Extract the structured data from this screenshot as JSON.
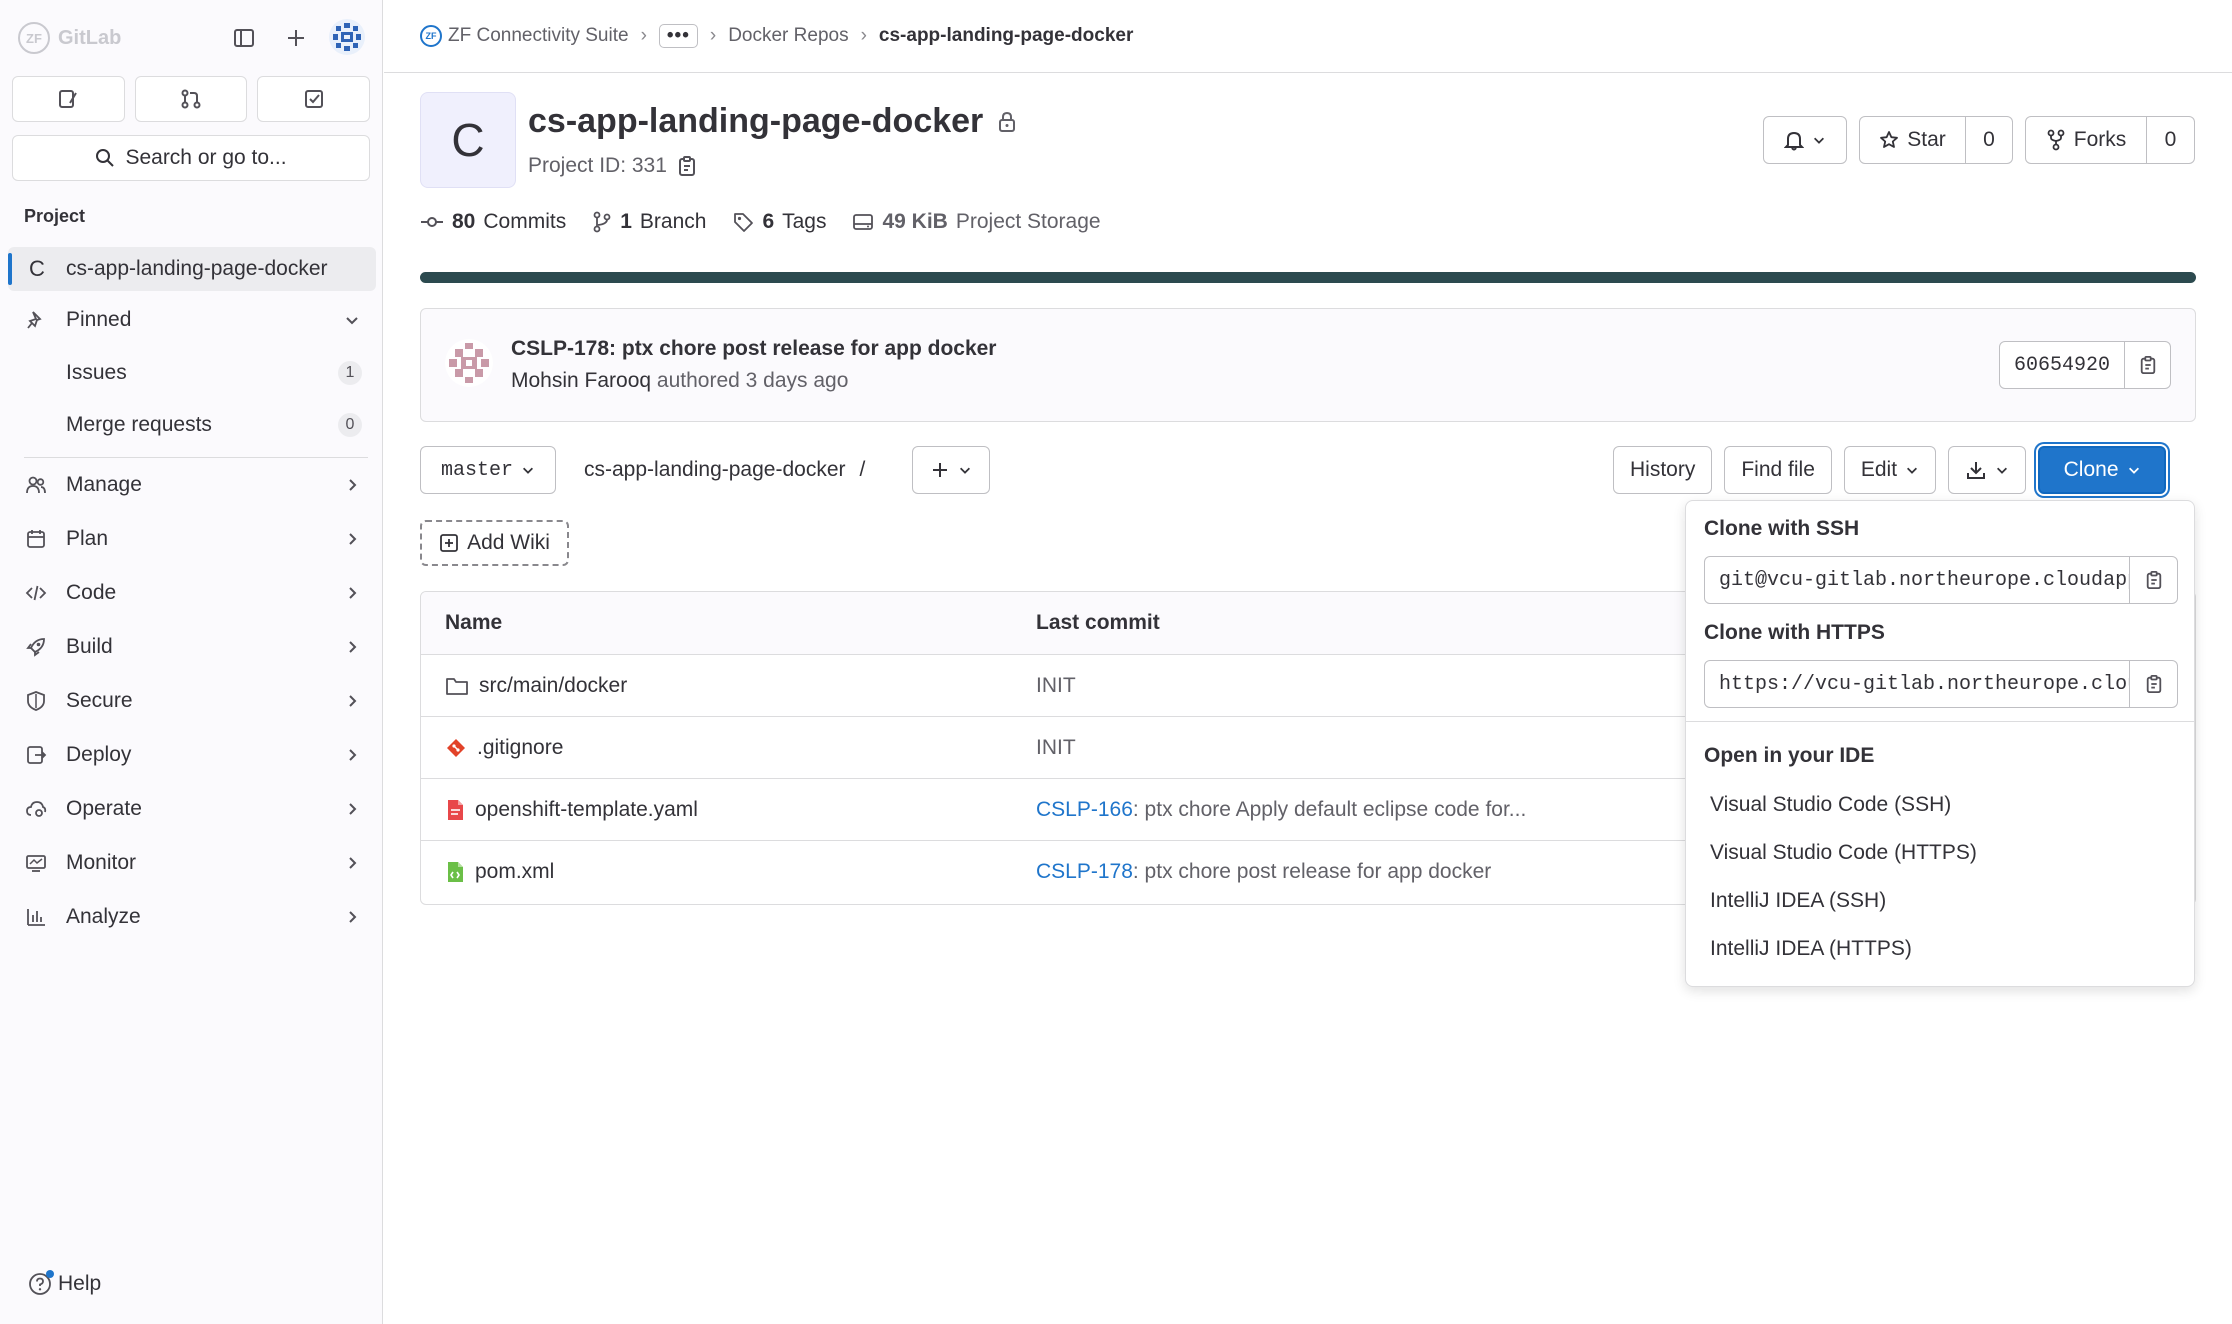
{
  "sidebar": {
    "brand": "GitLab",
    "search_placeholder": "Search or go to...",
    "section_title": "Project",
    "project_avatar_letter": "C",
    "project_name": "cs-app-landing-page-docker",
    "pinned_label": "Pinned",
    "pinned_items": [
      {
        "label": "Issues",
        "count": "1"
      },
      {
        "label": "Merge requests",
        "count": "0"
      }
    ],
    "nav_items": [
      {
        "label": "Manage",
        "icon": "users-icon"
      },
      {
        "label": "Plan",
        "icon": "calendar-icon"
      },
      {
        "label": "Code",
        "icon": "code-icon"
      },
      {
        "label": "Build",
        "icon": "rocket-icon"
      },
      {
        "label": "Secure",
        "icon": "shield-icon"
      },
      {
        "label": "Deploy",
        "icon": "deployments-icon"
      },
      {
        "label": "Operate",
        "icon": "cloud-gear-icon"
      },
      {
        "label": "Monitor",
        "icon": "monitor-icon"
      },
      {
        "label": "Analyze",
        "icon": "chart-icon"
      }
    ],
    "help_label": "Help"
  },
  "breadcrumb": {
    "group_logo": "ZF",
    "group": "ZF Connectivity Suite",
    "more": "•••",
    "subgroup": "Docker Repos",
    "current": "cs-app-landing-page-docker"
  },
  "project": {
    "avatar_letter": "C",
    "title": "cs-app-landing-page-docker",
    "id_label": "Project ID: 331",
    "star_label": "Star",
    "star_count": "0",
    "forks_label": "Forks",
    "forks_count": "0",
    "stats": {
      "commits_count": "80",
      "commits_label": "Commits",
      "branches_count": "1",
      "branches_label": "Branch",
      "tags_count": "6",
      "tags_label": "Tags",
      "storage_size": "49 KiB",
      "storage_label": "Project Storage"
    },
    "language_bar_color": "#2c4a4f"
  },
  "last_commit": {
    "title": "CSLP-178: ptx chore post release for app docker",
    "author": "Mohsin Farooq",
    "meta": "authored 3 days ago",
    "sha": "60654920"
  },
  "tree": {
    "branch": "master",
    "path": "cs-app-landing-page-docker",
    "path_sep": "/",
    "history_label": "History",
    "find_file_label": "Find file",
    "edit_label": "Edit",
    "clone_label": "Clone",
    "add_wiki_label": "Add Wiki",
    "columns": {
      "name": "Name",
      "last_commit": "Last commit"
    },
    "rows": [
      {
        "name": "src/main/docker",
        "icon": "folder-icon",
        "commit_ref": "",
        "commit_text": "INIT"
      },
      {
        "name": ".gitignore",
        "icon": "git-icon",
        "commit_ref": "",
        "commit_text": "INIT"
      },
      {
        "name": "openshift-template.yaml",
        "icon": "yaml-file-icon",
        "commit_ref": "CSLP-166",
        "commit_text": ": ptx chore Apply default eclipse code for..."
      },
      {
        "name": "pom.xml",
        "icon": "xml-file-icon",
        "commit_ref": "CSLP-178",
        "commit_text": ": ptx chore post release for app docker"
      }
    ]
  },
  "clone_dropdown": {
    "ssh_label": "Clone with SSH",
    "ssh_url": "git@vcu-gitlab.northeurope.cloudapp.azure.com:zf-connectivity-suite/docker-repos/cs-app-landing-page-docker.git",
    "https_label": "Clone with HTTPS",
    "https_url": "https://vcu-gitlab.northeurope.cloudapp.azure.com/zf-connectivity-suite/docker-repos/cs-app-landing-page-docker.git",
    "ide_label": "Open in your IDE",
    "ide_items": [
      "Visual Studio Code (SSH)",
      "Visual Studio Code (HTTPS)",
      "IntelliJ IDEA (SSH)",
      "IntelliJ IDEA (HTTPS)"
    ]
  },
  "colors": {
    "accent": "#1f75cb",
    "sidebar_bg": "#fbfafd",
    "text": "#333238"
  }
}
